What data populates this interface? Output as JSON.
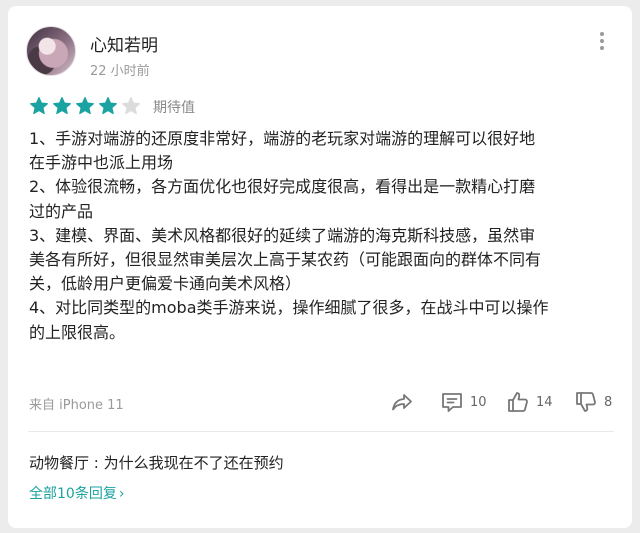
{
  "author": {
    "name": "心知若明",
    "time": "22 小时前"
  },
  "rating": {
    "stars": 4,
    "max": 5,
    "label": "期待值",
    "color": "#1aa3a0"
  },
  "review_lines": [
    "1、手游对端游的还原度非常好，端游的老玩家对端游的理解可以很好地",
    "在手游中也派上用场",
    "2、体验很流畅，各方面优化也很好完成度很高，看得出是一款精心打磨",
    "过的产品",
    "3、建模、界面、美术风格都很好的延续了端游的海克斯科技感，虽然审",
    "美各有所好，但很显然审美层次上高于某农药（可能跟面向的群体不同有",
    "关，低龄用户更偏爱卡通向美术风格）",
    "4、对比同类型的moba类手游来说，操作细腻了很多，在战斗中可以操作",
    "的上限很高。"
  ],
  "device": "来自 iPhone 11",
  "actions": {
    "share_icon": "share-icon",
    "comments_count": "10",
    "likes_count": "14",
    "dislikes_count": "8"
  },
  "reply": {
    "text": "动物餐厅 : 为什么我现在不了还在预约"
  },
  "all_replies_label": "全部10条回复",
  "all_replies_chevron": "›"
}
